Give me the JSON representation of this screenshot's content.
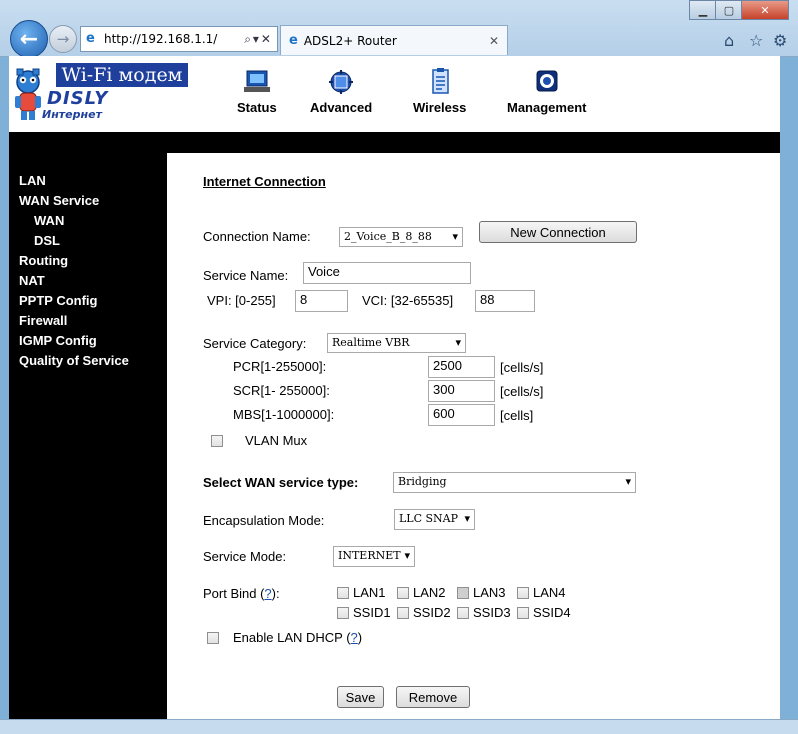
{
  "browser": {
    "address": "http://192.168.1.1/",
    "tab_title": "ADSL2+ Router"
  },
  "logo": {
    "product": "Wi-Fi модем",
    "brand": "DISLY",
    "sub": "Интернет"
  },
  "nav": [
    "Status",
    "Advanced",
    "Wireless",
    "Management"
  ],
  "sidebar": {
    "items": [
      {
        "label": "LAN"
      },
      {
        "label": "WAN Service"
      },
      {
        "label": "WAN"
      },
      {
        "label": "DSL"
      },
      {
        "label": "Routing"
      },
      {
        "label": "NAT"
      },
      {
        "label": "PPTP Config"
      },
      {
        "label": "Firewall"
      },
      {
        "label": "IGMP Config"
      },
      {
        "label": "Quality of Service"
      }
    ]
  },
  "form": {
    "title": "Internet Connection",
    "connection_name_label": "Connection Name:",
    "connection_name_value": "2_Voice_B_8_88",
    "new_connection_label": "New Connection",
    "service_name_label": "Service Name:",
    "service_name_value": "Voice",
    "vpi_label": "VPI: [0-255]",
    "vpi_value": "8",
    "vci_label": "VCI: [32-65535]",
    "vci_value": "88",
    "service_category_label": "Service Category:",
    "service_category_value": "Realtime VBR",
    "pcr_label": "PCR[1-255000]:",
    "pcr_value": "2500",
    "pcr_unit": "[cells/s]",
    "scr_label": "SCR[1- 255000]:",
    "scr_value": "300",
    "scr_unit": "[cells/s]",
    "mbs_label": "MBS[1-1000000]:",
    "mbs_value": "600",
    "mbs_unit": "[cells]",
    "vlan_mux_label": "VLAN Mux",
    "wan_type_label": "Select WAN service type:",
    "wan_type_value": "Bridging",
    "encap_label": "Encapsulation Mode:",
    "encap_value": "LLC SNAP",
    "service_mode_label": "Service Mode:",
    "service_mode_value": "INTERNET",
    "port_bind_label": "Port Bind (",
    "help_mark": "?",
    "port_bind_suffix": "):",
    "ports": [
      {
        "label": "LAN1",
        "checked": false
      },
      {
        "label": "LAN2",
        "checked": false
      },
      {
        "label": "LAN3",
        "checked": true
      },
      {
        "label": "LAN4",
        "checked": false
      },
      {
        "label": "SSID1",
        "checked": false
      },
      {
        "label": "SSID2",
        "checked": false
      },
      {
        "label": "SSID3",
        "checked": false
      },
      {
        "label": "SSID4",
        "checked": false
      }
    ],
    "enable_dhcp_label": "Enable LAN DHCP (",
    "enable_dhcp_suffix": ")",
    "save_label": "Save",
    "remove_label": "Remove"
  }
}
